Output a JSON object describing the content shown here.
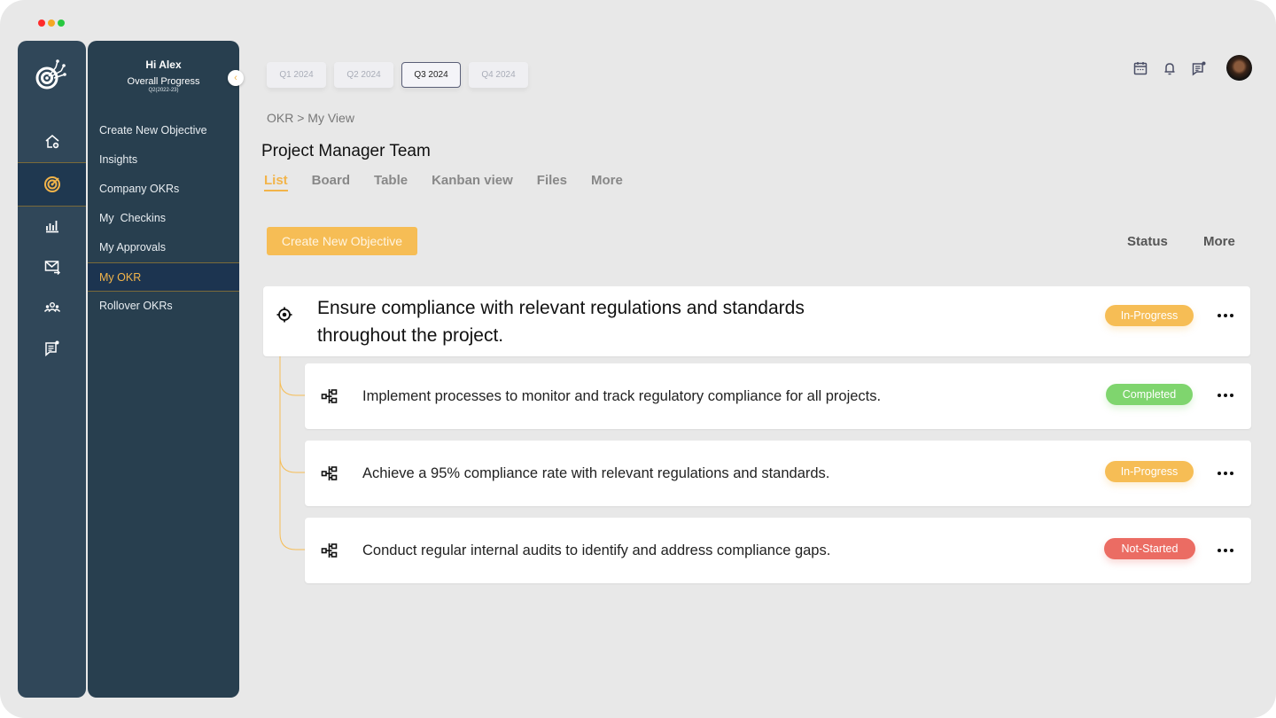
{
  "window": {
    "controls": [
      "close",
      "minimize",
      "maximize"
    ],
    "control_colors": [
      "#ff2b2b",
      "#f5a623",
      "#28c840"
    ]
  },
  "rail": {
    "logo": "target-network-logo-icon",
    "items": [
      {
        "icon": "home-add-icon",
        "active": false
      },
      {
        "icon": "target-icon",
        "active": true
      },
      {
        "icon": "bar-chart-icon",
        "active": false
      },
      {
        "icon": "mail-forward-icon",
        "active": false
      },
      {
        "icon": "team-icon",
        "active": false
      },
      {
        "icon": "chat-notification-icon",
        "active": false
      }
    ]
  },
  "menu": {
    "greeting": "Hi Alex",
    "progress_label": "Overall Progress",
    "period": "Q2(2022-23)",
    "items": [
      {
        "label": "Create New Objective",
        "active": false
      },
      {
        "label": "Insights",
        "active": false
      },
      {
        "label": "Company OKRs",
        "active": false
      },
      {
        "label": "My  Checkins",
        "active": false
      },
      {
        "label": "My Approvals",
        "active": false
      },
      {
        "label": "My OKR",
        "active": true
      },
      {
        "label": "Rollover OKRs",
        "active": false
      }
    ]
  },
  "quarters": [
    {
      "label": "Q1 2024",
      "active": false
    },
    {
      "label": "Q2 2024",
      "active": false
    },
    {
      "label": "Q3 2024",
      "active": true
    },
    {
      "label": "Q4 2024",
      "active": false
    }
  ],
  "breadcrumb": "OKR > My View",
  "page_title": "Project Manager Team",
  "views": [
    {
      "label": "List",
      "active": true
    },
    {
      "label": "Board",
      "active": false
    },
    {
      "label": "Table",
      "active": false
    },
    {
      "label": "Kanban view",
      "active": false
    },
    {
      "label": "Files",
      "active": false
    },
    {
      "label": "More",
      "active": false
    }
  ],
  "toolbar": {
    "create_label": "Create New Objective",
    "status_label": "Status",
    "more_label": "More"
  },
  "header_icons": [
    "calendar-icon",
    "bell-icon",
    "chat-notification-icon",
    "user-avatar"
  ],
  "status_colors": {
    "In-Progress": "#f6bd55",
    "Completed": "#7fd56e",
    "Not-Started": "#eb6c63"
  },
  "objective": {
    "title_line1": "Ensure compliance with relevant regulations and standards",
    "title_line2": "throughout the project.",
    "status": "In-Progress",
    "key_results": [
      {
        "title": "Implement processes to monitor and track regulatory compliance for all projects.",
        "status": "Completed"
      },
      {
        "title": "Achieve a 95% compliance rate with relevant regulations and standards.",
        "status": "In-Progress"
      },
      {
        "title": "Conduct regular internal audits to identify and address compliance gaps.",
        "status": "Not-Started"
      }
    ]
  },
  "accent_color": "#f6bd55"
}
